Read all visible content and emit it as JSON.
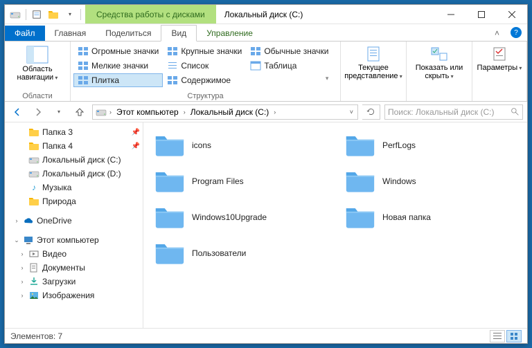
{
  "titlebar": {
    "context_tab": "Средства работы с дисками",
    "title": "Локальный диск (C:)"
  },
  "ribbon_tabs": {
    "file": "Файл",
    "home": "Главная",
    "share": "Поделиться",
    "view": "Вид",
    "manage": "Управление"
  },
  "ribbon": {
    "nav_pane": "Область навигации",
    "g1_label": "Области",
    "icons_xl": "Огромные значки",
    "icons_l": "Крупные значки",
    "icons_m": "Обычные значки",
    "icons_s": "Мелкие значки",
    "list": "Список",
    "table": "Таблица",
    "tiles": "Плитка",
    "content": "Содержимое",
    "g2_label": "Структура",
    "current_view": "Текущее представление",
    "show_hide": "Показать или скрыть",
    "options": "Параметры"
  },
  "breadcrumb": {
    "this_pc": "Этот компьютер",
    "drive": "Локальный диск (C:)"
  },
  "search": {
    "placeholder": "Поиск: Локальный диск (C:)"
  },
  "nav": {
    "folder3": "Папка 3",
    "folder4": "Папка 4",
    "drive_c": "Локальный диск (C:)",
    "drive_d": "Локальный диск (D:)",
    "music": "Музыка",
    "nature": "Природа",
    "onedrive": "OneDrive",
    "this_pc": "Этот компьютер",
    "video": "Видео",
    "documents": "Документы",
    "downloads": "Загрузки",
    "pictures": "Изображения"
  },
  "folders": {
    "f0": "icons",
    "f1": "PerfLogs",
    "f2": "Program Files",
    "f3": "Windows",
    "f4": "Windows10Upgrade",
    "f5": "Новая папка",
    "f6": "Пользователи"
  },
  "status": {
    "count_label": "Элементов: 7"
  }
}
